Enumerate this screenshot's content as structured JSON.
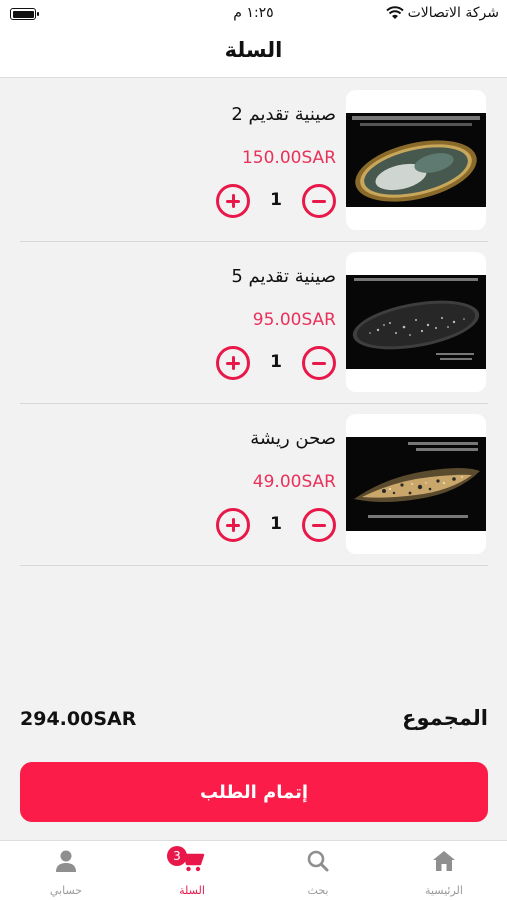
{
  "status_bar": {
    "carrier": "شركة الاتصالات",
    "time": "١:٢٥ م",
    "icons": [
      "wifi-icon",
      "battery-icon"
    ]
  },
  "header": {
    "title": "السلة"
  },
  "cart": {
    "items": [
      {
        "name": "صينية تقديم 2",
        "price": "150.00SAR",
        "quantity": "1",
        "image": "gold-rim-serving-tray"
      },
      {
        "name": "صينية تقديم 5",
        "price": "95.00SAR",
        "quantity": "1",
        "image": "oval-glitter-tray"
      },
      {
        "name": "صحن ريشة",
        "price": "49.00SAR",
        "quantity": "1",
        "image": "feather-shaped-plate"
      }
    ]
  },
  "total": {
    "label": "المجموع",
    "amount": "294.00SAR"
  },
  "checkout": {
    "label": "إتمام الطلب"
  },
  "tabbar": {
    "cart_badge": "3",
    "tabs": [
      {
        "label": "الرئيسية",
        "icon": "home-icon"
      },
      {
        "label": "بحث",
        "icon": "search-icon"
      },
      {
        "label": "السلة",
        "icon": "cart-icon",
        "active": true
      },
      {
        "label": "حسابي",
        "icon": "user-icon"
      }
    ]
  },
  "colors": {
    "accent": "#e8194a",
    "checkout_button": "#fb1c49",
    "price": "#e8315b",
    "tab_inactive": "#9a9a9a"
  }
}
